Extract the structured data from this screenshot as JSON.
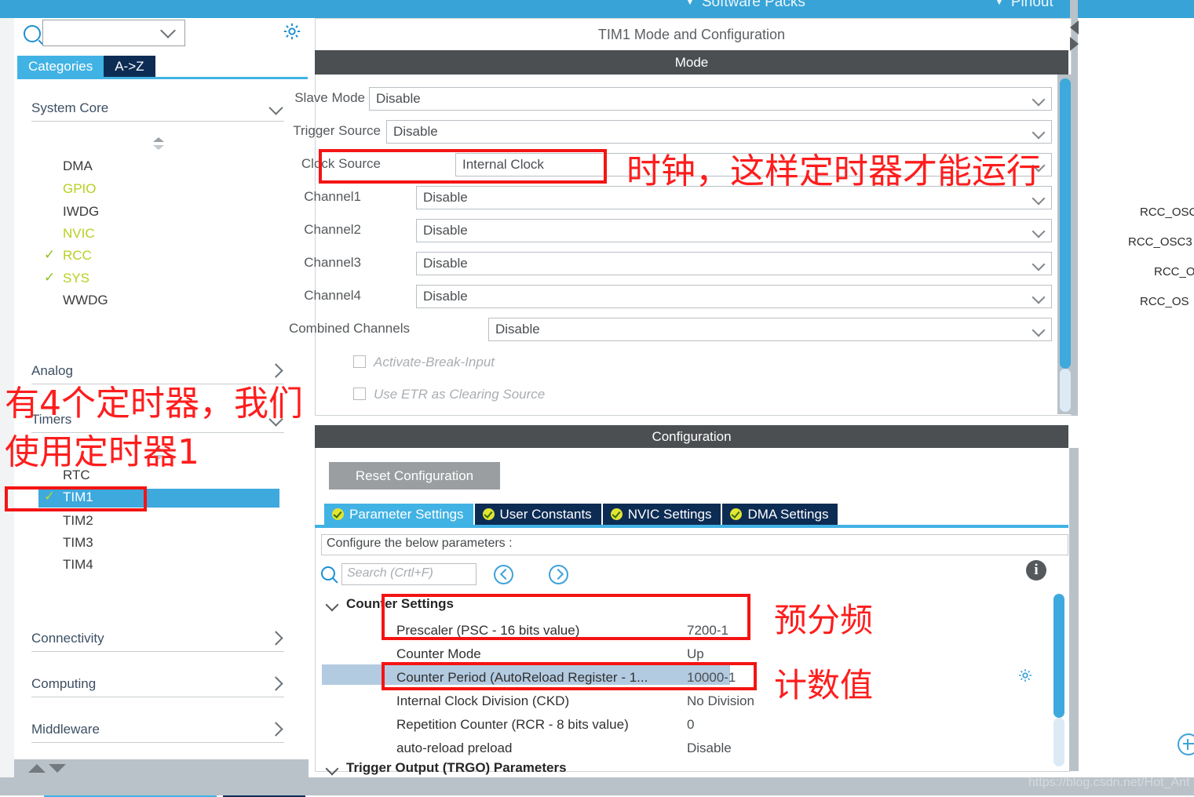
{
  "topbar": {
    "menus": [
      {
        "label": "Software Packs",
        "icon": "chevron-down-icon"
      },
      {
        "label": "Pinout",
        "icon": "chevron-down-icon"
      }
    ]
  },
  "sidebar": {
    "search": {
      "value": "",
      "placeholder": "",
      "icon": "search-icon"
    },
    "gear_icon": "gear-icon",
    "tabs": [
      {
        "label": "Categories",
        "selected": true
      },
      {
        "label": "A->Z",
        "selected": false
      }
    ],
    "groups": [
      {
        "label": "System Core",
        "expanded": true,
        "items": [
          {
            "label": "DMA",
            "state": "none"
          },
          {
            "label": "GPIO",
            "state": "partial"
          },
          {
            "label": "IWDG",
            "state": "none"
          },
          {
            "label": "NVIC",
            "state": "partial"
          },
          {
            "label": "RCC",
            "state": "checked"
          },
          {
            "label": "SYS",
            "state": "checked"
          },
          {
            "label": "WWDG",
            "state": "none"
          }
        ]
      },
      {
        "label": "Analog",
        "expanded": false,
        "items": []
      },
      {
        "label": "Timers",
        "expanded": true,
        "items": [
          {
            "label": "RTC",
            "state": "none"
          },
          {
            "label": "TIM1",
            "state": "checked",
            "selected": true
          },
          {
            "label": "TIM2",
            "state": "none"
          },
          {
            "label": "TIM3",
            "state": "none"
          },
          {
            "label": "TIM4",
            "state": "none"
          }
        ]
      },
      {
        "label": "Connectivity",
        "expanded": false,
        "items": []
      },
      {
        "label": "Computing",
        "expanded": false,
        "items": []
      },
      {
        "label": "Middleware",
        "expanded": false,
        "items": []
      }
    ]
  },
  "mode_panel": {
    "title": "TIM1 Mode and Configuration",
    "section_header": "Mode",
    "fields": [
      {
        "label": "Slave Mode",
        "value": "Disable"
      },
      {
        "label": "Trigger Source",
        "value": "Disable"
      },
      {
        "label": "Clock Source",
        "value": "Internal Clock"
      },
      {
        "label": "Channel1",
        "value": "Disable"
      },
      {
        "label": "Channel2",
        "value": "Disable"
      },
      {
        "label": "Channel3",
        "value": "Disable"
      },
      {
        "label": "Channel4",
        "value": "Disable"
      },
      {
        "label": "Combined Channels",
        "value": "Disable"
      }
    ],
    "checkboxes": [
      {
        "label": "Activate-Break-Input",
        "checked": false
      },
      {
        "label": "Use ETR as Clearing Source",
        "checked": false
      }
    ]
  },
  "config_panel": {
    "section_header": "Configuration",
    "reset_label": "Reset Configuration",
    "tabs": [
      {
        "label": "Parameter Settings",
        "selected": true
      },
      {
        "label": "User Constants",
        "selected": false
      },
      {
        "label": "NVIC Settings",
        "selected": false
      },
      {
        "label": "DMA Settings",
        "selected": false
      }
    ],
    "configure_hint": "Configure the below parameters :",
    "search_placeholder": "Search (Crtl+F)",
    "nav_prev_icon": "chevron-left-circle-icon",
    "nav_next_icon": "chevron-right-circle-icon",
    "info_icon": "info-icon",
    "groups": [
      {
        "label": "Counter Settings",
        "expanded": true,
        "rows": [
          {
            "name": "Prescaler (PSC - 16 bits value)",
            "value": "7200-1"
          },
          {
            "name": "Counter Mode",
            "value": "Up"
          },
          {
            "name": "Counter Period (AutoReload Register - 1...",
            "value": "10000-1",
            "selected": true,
            "gear_icon": "gear-icon"
          },
          {
            "name": "Internal Clock Division (CKD)",
            "value": "No Division"
          },
          {
            "name": "Repetition Counter (RCR - 8 bits value)",
            "value": "0"
          },
          {
            "name": "auto-reload preload",
            "value": "Disable"
          }
        ]
      },
      {
        "label": "Trigger Output (TRGO) Parameters",
        "expanded": true,
        "rows": []
      }
    ]
  },
  "pinout": {
    "labels": [
      "RCC_OSC",
      "RCC_OSC3",
      "RCC_O",
      "RCC_OS"
    ],
    "zoom_in_icon": "zoom-in-icon"
  },
  "annotations": [
    {
      "id": "clock-note",
      "text": "时钟，这样定时器才能运行"
    },
    {
      "id": "timers-note-line1",
      "text": "有4个定时器，我们"
    },
    {
      "id": "timers-note-line2",
      "text": "使用定时器1"
    },
    {
      "id": "prescaler-note",
      "text": "预分频"
    },
    {
      "id": "period-note",
      "text": "计数值"
    }
  ],
  "watermark": "https://blog.csdn.net/Hot_Ant",
  "colors": {
    "accent_blue": "#3ea9dd",
    "dark_navy": "#0d2c54",
    "header_gray": "#4c4f51",
    "annotation_red": "#fe1d1d",
    "check_green": "#8ec320",
    "partial_yellow": "#b9cf20"
  }
}
